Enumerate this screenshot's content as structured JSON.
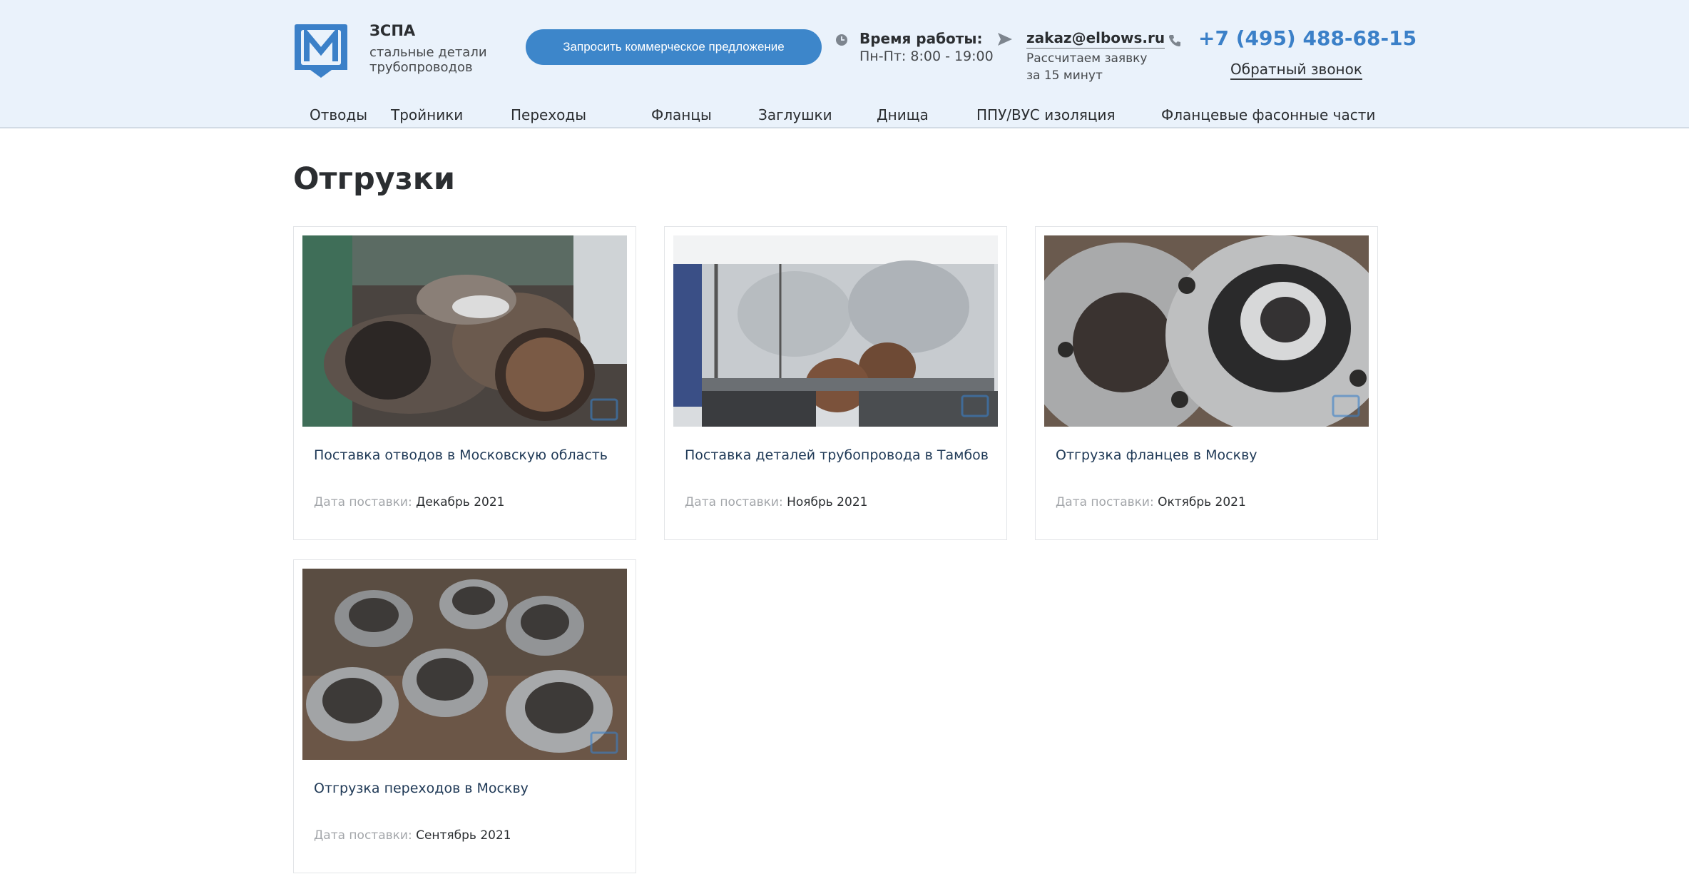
{
  "brand": {
    "name": "ЗСПА",
    "subtitle": "стальные детали трубопроводов",
    "logo_letter": "M",
    "color": "#3b80c8"
  },
  "header": {
    "cta_label": "Запросить коммерческое предложение",
    "hours_title": "Время работы:",
    "hours_value": "Пн-Пт: 8:00 - 19:00",
    "email": "zakaz@elbows.ru",
    "email_note": "Рассчитаем заявку за 15 минут",
    "phone": "+7 (495) 488-68-15",
    "callback_label": "Обратный звонок"
  },
  "nav": {
    "items": [
      {
        "label": "Отводы"
      },
      {
        "label": "Тройники"
      },
      {
        "label": "Переходы"
      },
      {
        "label": "Фланцы"
      },
      {
        "label": "Заглушки"
      },
      {
        "label": "Днища"
      },
      {
        "label": "ППУ/ВУС изоляция"
      },
      {
        "label": "Фланцевые фасонные части"
      }
    ]
  },
  "page": {
    "title": "Отгрузки"
  },
  "shipments": {
    "date_label": "Дата поставки:",
    "items": [
      {
        "title": "Поставка отводов в Московскую область",
        "date": "Декабрь 2021",
        "image": "pipe-elbows-photo"
      },
      {
        "title": "Поставка деталей трубопровода в Тамбов",
        "date": "Ноябрь 2021",
        "image": "truck-loaded-photo"
      },
      {
        "title": "Отгрузка фланцев в Москву",
        "date": "Октябрь 2021",
        "image": "flanges-photo"
      },
      {
        "title": "Отгрузка переходов в Москву",
        "date": "Сентябрь 2021",
        "image": "reducers-photo"
      }
    ]
  },
  "colors": {
    "header_bg": "#eaf2fb",
    "accent": "#3d86ca",
    "link": "#203a57"
  }
}
